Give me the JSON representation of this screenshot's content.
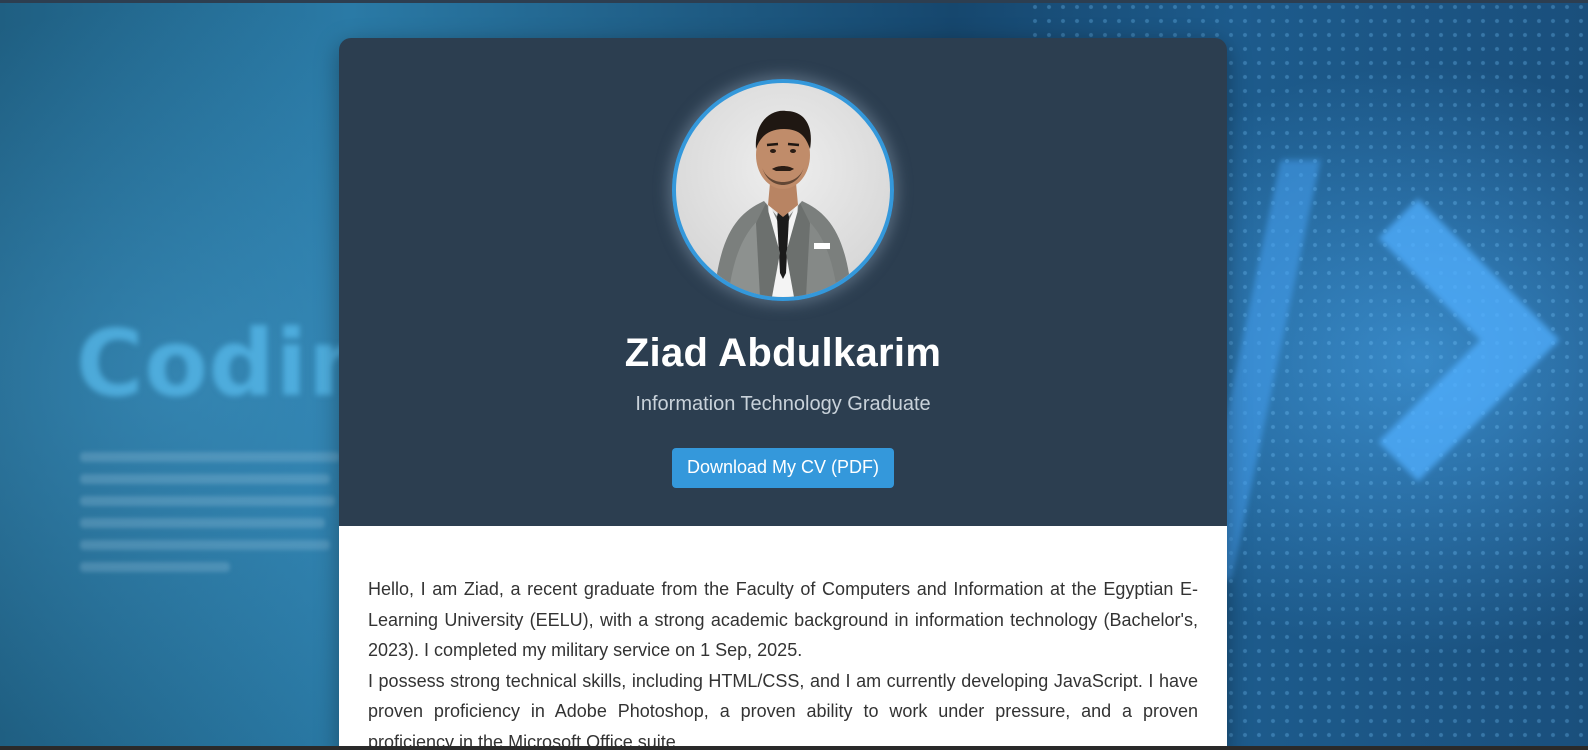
{
  "profile": {
    "name": "Ziad Abdulkarim",
    "title": "Information Technology Graduate",
    "cv_button_label": "Download My CV (PDF)",
    "avatar_alt": "Ziad Abdulkarim"
  },
  "about": {
    "paragraphs": [
      "Hello, I am Ziad, a recent graduate from the Faculty of Computers and Information at the Egyptian E-Learning University (EELU), with a strong academic background in information technology (Bachelor's, 2023). I completed my military service on 1 Sep, 2025.",
      "I possess strong technical skills, including HTML/CSS, and I am currently developing JavaScript. I have proven proficiency in Adobe Photoshop, a proven ability to work under pressure, and a proven proficiency in the Microsoft Office suite."
    ]
  },
  "background": {
    "headline": "Coding"
  },
  "colors": {
    "header_bg": "#2c3e50",
    "accent": "#3498db",
    "body_bg": "#ffffff"
  }
}
